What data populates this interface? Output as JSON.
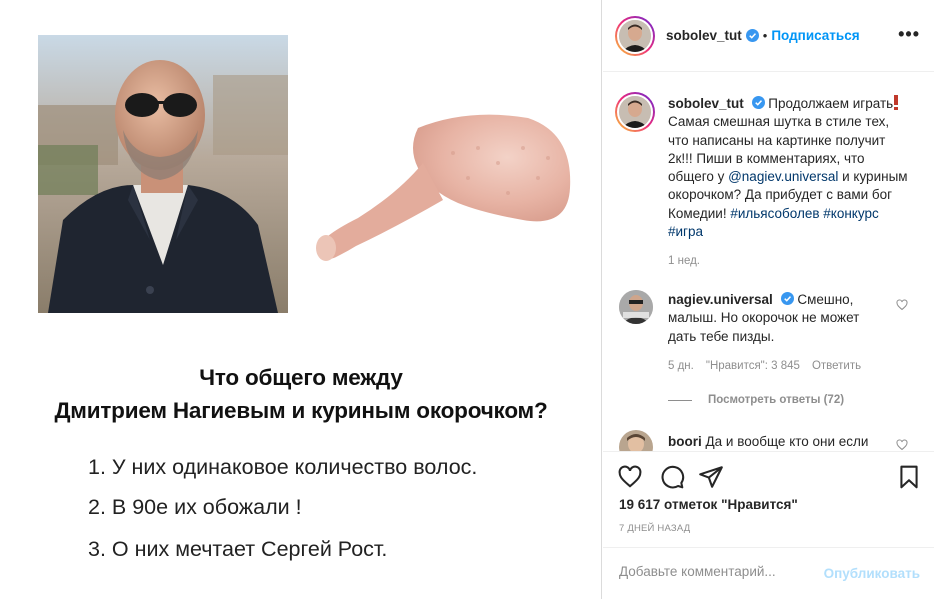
{
  "post_image": {
    "headline_line1": "Что общего между",
    "headline_line2": "Дмитрием Нагиевым и куриным окорочком?",
    "points": [
      "1. У них одинаковое количество волос.",
      "2. В 90е их обожали !",
      "3. О них мечтает Сергей Рост."
    ]
  },
  "header": {
    "username": "sobolev_tut",
    "separator": "•",
    "follow_label": "Подписаться",
    "more_label": "•••"
  },
  "caption": {
    "username": "sobolev_tut",
    "text_part1": "Продолжаем играть",
    "text_part2": "Самая смешная шутка в стиле тех, что написаны на картинке получит 2к!!! Пиши в комментариях, что общего у ",
    "mention": "@nagiev.universal",
    "text_part3": " и куриным окорочком? Да прибудет с вами бог Комедии! ",
    "hashtag1": "#ильясоболев",
    "hashtag2": "#конкурс",
    "hashtag3": "#игра",
    "time": "1 нед."
  },
  "comments": [
    {
      "username": "nagiev.universal",
      "text": "Смешно, малыш. Но окорочок не может дать тебе пизды.",
      "time": "5 дн.",
      "likes": "\"Нравится\": 3 845",
      "reply_label": "Ответить",
      "view_replies": "Посмотреть ответы (72)"
    },
    {
      "username": "boori",
      "text": "Да и вообще кто они если"
    }
  ],
  "actions": {
    "likes_text": "19 617 отметок \"Нравится\"",
    "date": "7 ДНЕЙ НАЗАД"
  },
  "add_comment": {
    "placeholder": "Добавьте комментарий...",
    "post_label": "Опубликовать"
  },
  "colors": {
    "link_blue": "#0095f6",
    "hashtag": "#00376b",
    "muted": "#8e8e8e",
    "post_disabled": "#b2dffc",
    "verified": "#3897f0"
  }
}
